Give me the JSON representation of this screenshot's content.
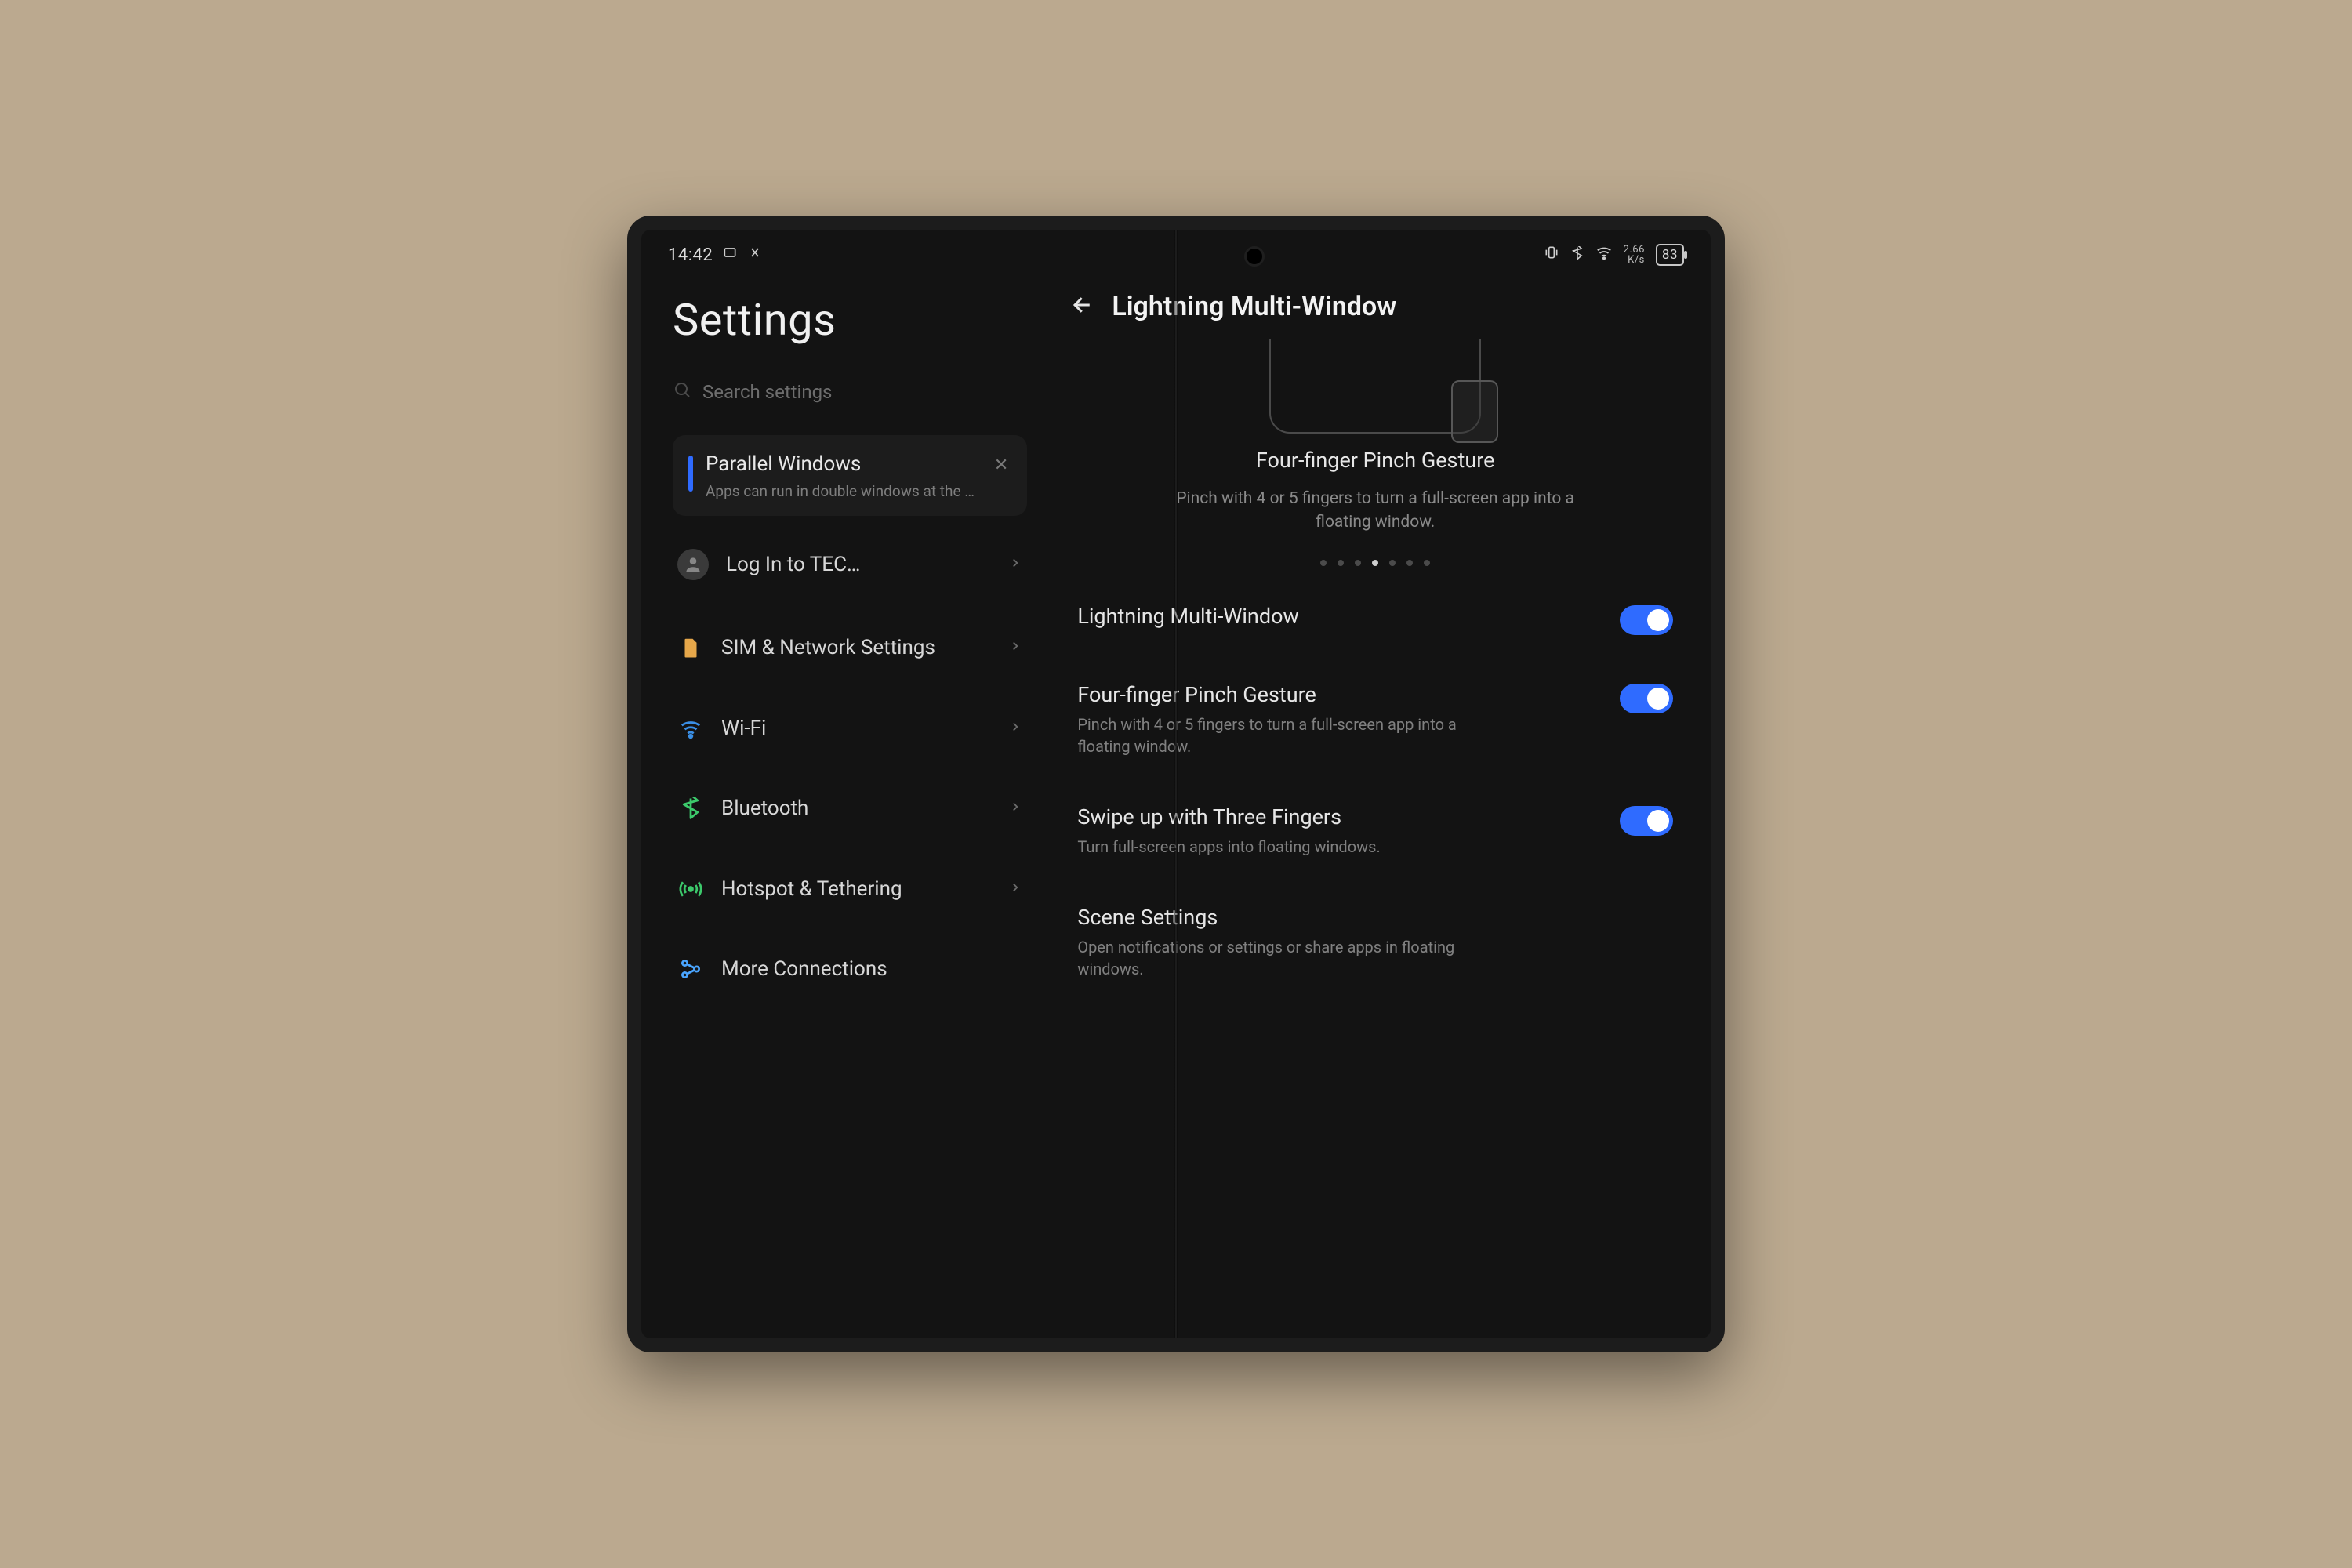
{
  "status": {
    "time": "14:42",
    "net_rate": "2.66",
    "net_unit": "K/s",
    "battery": "83"
  },
  "left": {
    "title": "Settings",
    "search_placeholder": "Search settings",
    "card": {
      "title": "Parallel Windows",
      "subtitle": "Apps can run in double windows at the same ti…"
    },
    "login_label": "Log In to TEC…",
    "items": {
      "sim": "SIM & Network Settings",
      "wifi": "Wi-Fi",
      "bluetooth": "Bluetooth",
      "hotspot": "Hotspot & Tethering",
      "more": "More Connections"
    }
  },
  "right": {
    "title": "Lightning Multi-Window",
    "hero": {
      "title": "Four-finger Pinch Gesture",
      "subtitle": "Pinch with 4 or 5 fingers to turn a full-screen app into a floating window."
    },
    "options": {
      "lmw": {
        "title": "Lightning Multi-Window"
      },
      "pinch": {
        "title": "Four-finger Pinch Gesture",
        "subtitle": "Pinch with 4 or 5 fingers to turn a full-screen app into a floating window."
      },
      "swipe": {
        "title": "Swipe up with Three Fingers",
        "subtitle": "Turn full-screen apps into floating windows."
      },
      "scene": {
        "title": "Scene Settings",
        "subtitle": "Open notifications or settings or share apps in floating windows."
      }
    }
  }
}
